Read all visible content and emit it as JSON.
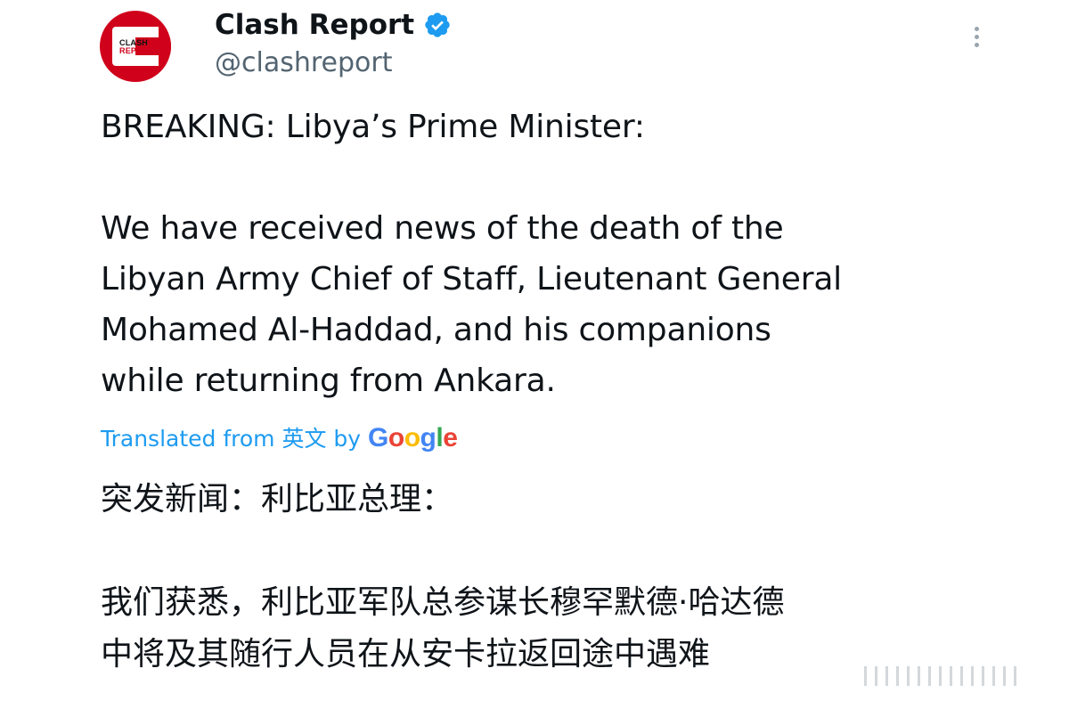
{
  "author": {
    "display_name": "Clash Report",
    "handle": "@clashreport",
    "avatar_text_top": "CLASH",
    "avatar_text_bottom": "REPORT",
    "brand_color": "#d0021b",
    "verified_color": "#1d9bf0"
  },
  "tweet": {
    "lines_para1": [
      "BREAKING: Libya’s Prime Minister:"
    ],
    "lines_para2": [
      "We have received news of the death of the",
      "Libyan Army Chief of Staff, Lieutenant General",
      "Mohamed Al-Haddad, and his companions",
      "while returning from Ankara."
    ]
  },
  "translation_note": {
    "prefix": "Translated from 英文 by",
    "provider": [
      "G",
      "o",
      "o",
      "g",
      "l",
      "e"
    ]
  },
  "translation": {
    "lines_para1": [
      "突发新闻：利比亚总理："
    ],
    "lines_para2": [
      "我们获悉，利比亚军队总参谋长穆罕默德·哈达德",
      "中将及其随行人员在从安卡拉返回途中遇难"
    ]
  },
  "icons": {
    "verified": "verified-badge-icon",
    "more": "more-options-icon"
  }
}
